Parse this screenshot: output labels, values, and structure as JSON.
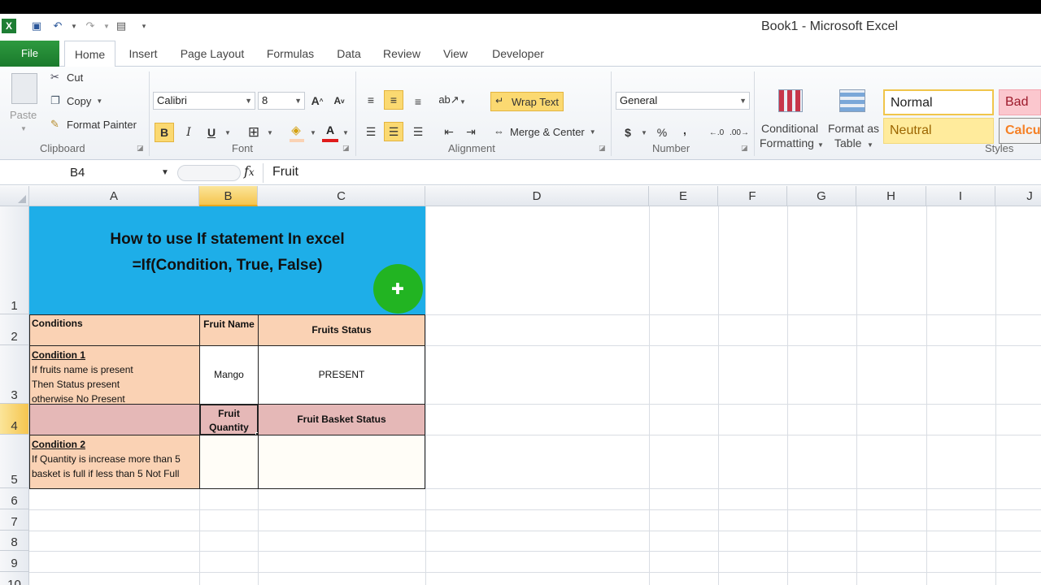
{
  "window": {
    "title": "Book1  -  Microsoft Excel"
  },
  "tabs": [
    "File",
    "Home",
    "Insert",
    "Page Layout",
    "Formulas",
    "Data",
    "Review",
    "View",
    "Developer"
  ],
  "ribbon": {
    "clipboard": {
      "paste": "Paste",
      "cut": "Cut",
      "copy": "Copy",
      "format_painter": "Format Painter",
      "label": "Clipboard"
    },
    "font": {
      "name": "Calibri",
      "size": "8",
      "bold": "B",
      "italic": "I",
      "underline": "U",
      "label": "Font"
    },
    "alignment": {
      "wrap_text": "Wrap Text",
      "merge_center": "Merge & Center",
      "label": "Alignment"
    },
    "number": {
      "format": "General",
      "currency": "$",
      "percent": "%",
      "comma": ",",
      "label": "Number"
    },
    "styles": {
      "conditional_formatting_1": "Conditional",
      "conditional_formatting_2": "Formatting",
      "format_as_table_1": "Format as",
      "format_as_table_2": "Table",
      "normal": "Normal",
      "bad": "Bad",
      "neutral": "Neutral",
      "calc": "Calcul",
      "label": "Styles"
    }
  },
  "formula_bar": {
    "name_box": "B4",
    "fx": "fx",
    "value": "Fruit"
  },
  "columns": [
    "A",
    "B",
    "C",
    "D",
    "E",
    "F",
    "G",
    "H",
    "I",
    "J"
  ],
  "rows": [
    "1",
    "2",
    "3",
    "4",
    "5",
    "6",
    "7",
    "8",
    "9",
    "10"
  ],
  "cells": {
    "title_line1": "How to use If statement In excel",
    "title_line2": "=If(Condition, True, False)",
    "a2": "Conditions",
    "b2": "Fruit Name",
    "c2": "Fruits Status",
    "a3_head": "Condition 1",
    "a3_l1": "If fruits name is present",
    "a3_l2": "Then Status present",
    "a3_l3": "otherwise No Present",
    "b3": "Mango",
    "c3": "PRESENT",
    "b4": "Fruit Quantity",
    "c4": "Fruit Basket Status",
    "a5_head": "Condition 2",
    "a5_l1": "If Quantity is increase more than 5",
    "a5_l2": "basket is full if less than 5 Not Full"
  },
  "colors": {
    "title_fill": "#1eaee8",
    "peach": "#fad2b4",
    "pink": "#e5b8b7",
    "cursor": "#22b422"
  }
}
